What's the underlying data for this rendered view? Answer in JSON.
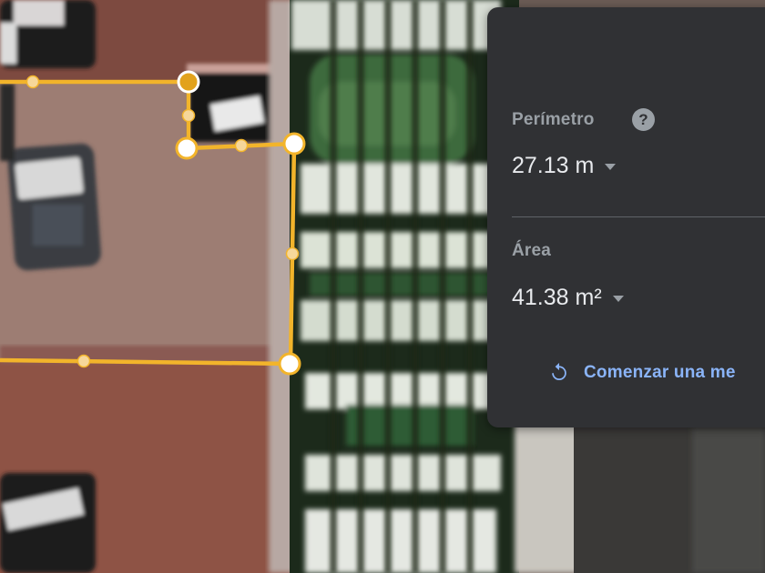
{
  "measure_panel": {
    "perimeter": {
      "label": "Perímetro",
      "help_icon_glyph": "?",
      "value": "27.13 m"
    },
    "area": {
      "label": "Área",
      "value": "41.38 m²"
    },
    "restart": {
      "label": "Comenzar una me",
      "icon": "restart-icon"
    }
  },
  "colors": {
    "panel_bg": "#303134",
    "label_text": "#9aa0a6",
    "value_text": "#e8eaed",
    "link_blue": "#8ab4f8",
    "measure_line": "#f2b42b"
  }
}
